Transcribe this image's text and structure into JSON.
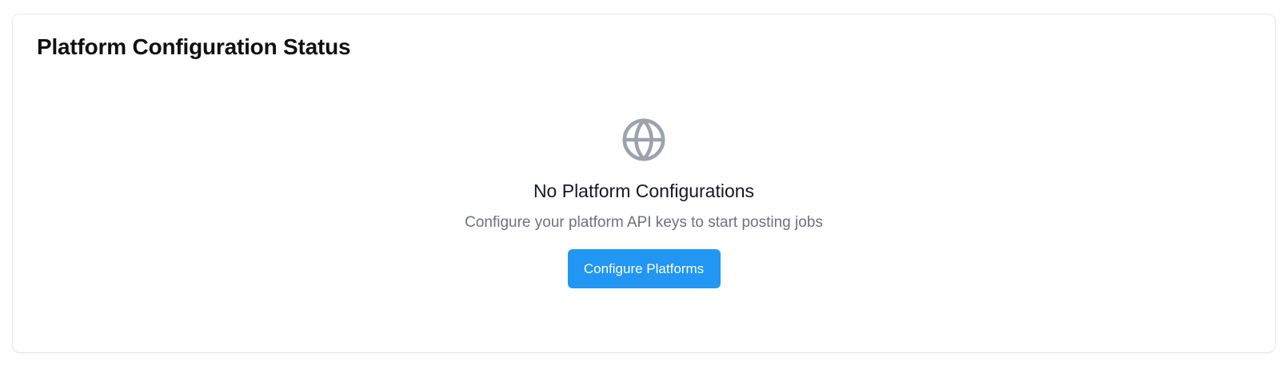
{
  "card": {
    "title": "Platform Configuration Status"
  },
  "empty_state": {
    "icon": "globe-icon",
    "heading": "No Platform Configurations",
    "description": "Configure your platform API keys to start posting jobs",
    "button_label": "Configure Platforms"
  },
  "colors": {
    "accent": "#2196f3",
    "icon": "#9ca3af",
    "muted_text": "#6b7280"
  }
}
